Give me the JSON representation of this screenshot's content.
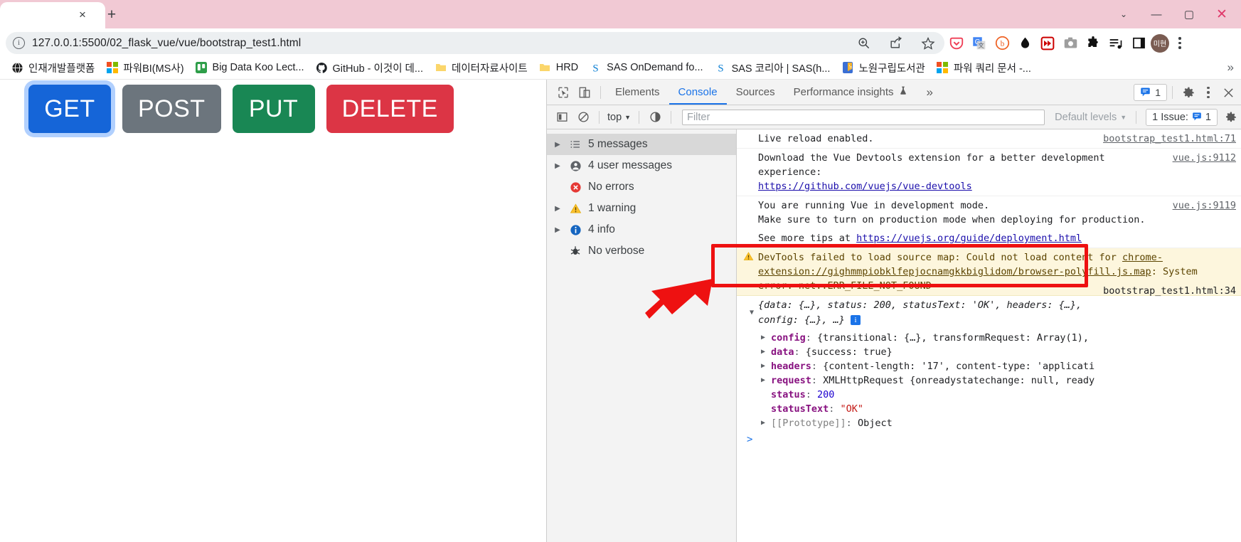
{
  "browser": {
    "tab": {
      "close_label": "×",
      "newtab_label": "+"
    },
    "window_controls": {
      "minimize": "—",
      "maximize": "▢",
      "close": "✕",
      "chevron": "⌄"
    },
    "omnibox": {
      "url": "127.0.0.1:5500/02_flask_vue/vue/bootstrap_test1.html",
      "info_icon": "i",
      "actions": [
        "zoom-icon",
        "share-icon",
        "bookmark-star-icon"
      ]
    },
    "extensions": [
      "pocket-icon",
      "google-translate-icon",
      "bitly-icon",
      "dark-reader-icon",
      "video-speed-icon",
      "screenshot-icon",
      "puzzle-extensions-icon",
      "playlist-icon",
      "sidepanel-icon"
    ],
    "profile_initials": "미현",
    "bookmarks": [
      {
        "label": "인재개발플랫폼",
        "icon": "globe-icon"
      },
      {
        "label": "파워BI(MS사)",
        "icon": "microsoft-icon"
      },
      {
        "label": "Big Data Koo Lect...",
        "icon": "trello-icon"
      },
      {
        "label": "GitHub - 이것이 데...",
        "icon": "github-icon"
      },
      {
        "label": "데이터자료사이트",
        "icon": "folder-icon"
      },
      {
        "label": "HRD",
        "icon": "folder-icon"
      },
      {
        "label": "SAS OnDemand fo...",
        "icon": "sas-icon"
      },
      {
        "label": "SAS 코리아 | SAS(h...",
        "icon": "sas-icon"
      },
      {
        "label": "노원구립도서관",
        "icon": "library-icon"
      },
      {
        "label": "파워 쿼리 문서 -...",
        "icon": "microsoft-icon"
      }
    ],
    "bookmarks_overflow": "»"
  },
  "page": {
    "buttons": [
      {
        "label": "GET",
        "color": "#1565d8",
        "focused": true
      },
      {
        "label": "POST",
        "color": "#6c757d",
        "focused": false
      },
      {
        "label": "PUT",
        "color": "#198754",
        "focused": false
      },
      {
        "label": "DELETE",
        "color": "#dc3545",
        "focused": false
      }
    ]
  },
  "devtools": {
    "tools": {
      "inspect": "inspect-element-icon",
      "device": "device-toolbar-icon"
    },
    "tabs": [
      {
        "label": "Elements",
        "active": false
      },
      {
        "label": "Console",
        "active": true
      },
      {
        "label": "Sources",
        "active": false
      },
      {
        "label": "Performance insights",
        "active": false,
        "badge": "flask-icon"
      }
    ],
    "more_tabs": "»",
    "message_badge_count": "1",
    "settings_icon": "gear-icon",
    "more_icon": "kebab-menu-icon",
    "close_icon": "close-icon",
    "filterbar": {
      "sidebar_toggle": "sidebar-toggle-icon",
      "clear_console": "clear-console-icon",
      "context": "top",
      "eye_icon": "live-expression-icon",
      "filter_placeholder": "Filter",
      "filter_value": "",
      "levels": "Default levels",
      "issues_label": "1 Issue:",
      "issues_count": "1",
      "settings_icon": "gear-icon"
    },
    "sidebar": [
      {
        "label": "5 messages",
        "icon": "list-icon",
        "expandable": true,
        "selected": true
      },
      {
        "label": "4 user messages",
        "icon": "user-icon",
        "expandable": true,
        "selected": false
      },
      {
        "label": "No errors",
        "icon": "error-icon",
        "expandable": false,
        "selected": false
      },
      {
        "label": "1 warning",
        "icon": "warning-icon",
        "expandable": true,
        "selected": false
      },
      {
        "label": "4 info",
        "icon": "info-icon",
        "expandable": true,
        "selected": false
      },
      {
        "label": "No verbose",
        "icon": "verbose-icon",
        "expandable": false,
        "selected": false
      }
    ],
    "console": {
      "rows": [
        {
          "text": "Live reload enabled.",
          "source": "bootstrap_test1.html:71"
        },
        {
          "text": "Download the Vue Devtools extension for a better development experience:",
          "link": "https://github.com/vuejs/vue-devtools",
          "source": "vue.js:9112"
        },
        {
          "text": "You are running Vue in development mode.",
          "text2": "Make sure to turn on production mode when deploying for production.",
          "source": "vue.js:9119"
        },
        {
          "text": "See more tips at ",
          "link": "https://vuejs.org/guide/deployment.html"
        }
      ],
      "warning": {
        "icon": "warning-icon",
        "part1": "DevTools failed to load source map: Could not load content for ",
        "link": "chrome-extension://gighmmpiobklfepjocnamgkkbiglidom/browser-polyfill.js.map",
        "part2": ": System error: net::ERR_FILE_NOT_FOUND"
      },
      "object": {
        "source": "bootstrap_test1.html:34",
        "preview_line1": "{data: {…}, status: 200, statusText: 'OK', headers: {…},",
        "preview_line2": "config: {…}, …}",
        "info_badge": "i",
        "props": [
          {
            "key": "config",
            "value": "{transitional: {…}, transformRequest: Array(1),",
            "expandable": true
          },
          {
            "key": "data",
            "value": "{success: true}",
            "expandable": true
          },
          {
            "key": "headers",
            "value": "{content-length: '17', content-type: 'applicati",
            "expandable": true
          },
          {
            "key": "request",
            "value": "XMLHttpRequest {onreadystatechange: null, ready",
            "expandable": true
          },
          {
            "key": "status",
            "value": "200",
            "expandable": false
          },
          {
            "key": "statusText",
            "value": "\"OK\"",
            "expandable": false
          },
          {
            "key": "[[Prototype]]",
            "value": "Object",
            "expandable": true
          }
        ]
      },
      "prompt_caret": ">"
    }
  },
  "annotations": {
    "highlight_box_color": "#ee1111",
    "arrow_color": "#ee1111"
  }
}
